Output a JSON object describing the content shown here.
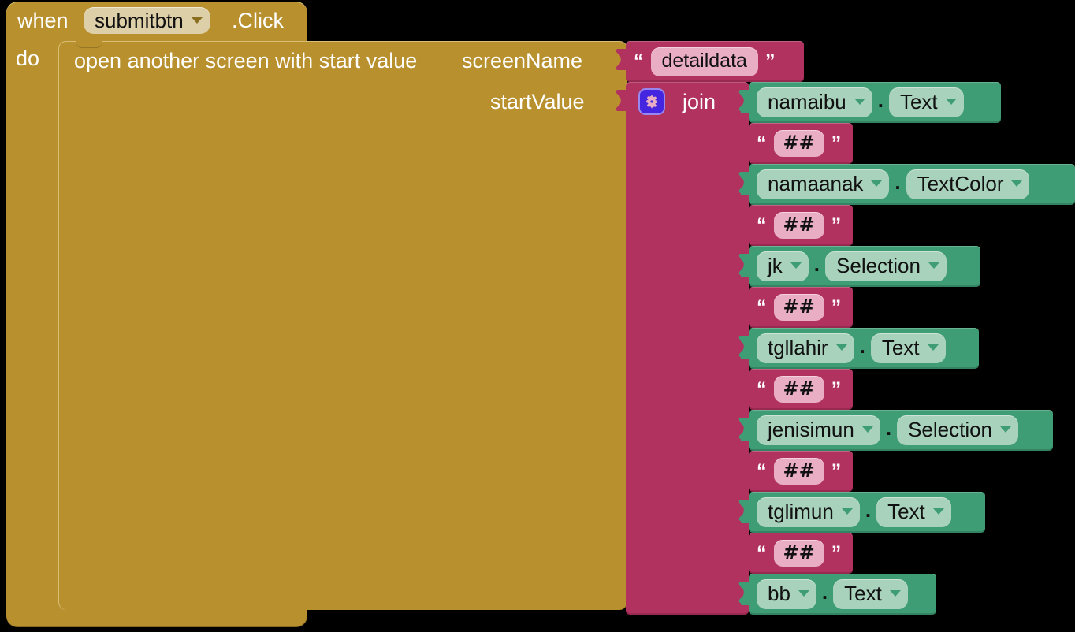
{
  "workspace": {
    "background_color": "#000000",
    "block_colors": {
      "control_gold": "#b8902e",
      "text_crimson": "#b1325f",
      "component_green": "#3f9d75",
      "field_pink": "#e9aec4",
      "field_green": "#a9d2bd",
      "field_gold": "#ddd0a8",
      "mutator_blue": "#4425e0"
    }
  },
  "event_block": {
    "when_label": "when",
    "component": "submitbtn",
    "event": ".Click",
    "do_label": "do"
  },
  "statement_block": {
    "label": "open another screen with start value",
    "sockets": [
      {
        "name": "screenName"
      },
      {
        "name": "startValue"
      }
    ]
  },
  "screen_name_value": {
    "type": "text",
    "open_quote": "“",
    "close_quote": "”",
    "value": "detaildata"
  },
  "join_block": {
    "mutator_icon": "gear-icon",
    "label": "join",
    "items": [
      {
        "kind": "component",
        "component": "namaibu",
        "dot": ".",
        "property": "Text"
      },
      {
        "kind": "text",
        "open_quote": "“",
        "value": "##",
        "close_quote": "”"
      },
      {
        "kind": "component",
        "component": "namaanak",
        "dot": ".",
        "property": "TextColor"
      },
      {
        "kind": "text",
        "open_quote": "“",
        "value": "##",
        "close_quote": "”"
      },
      {
        "kind": "component",
        "component": "jk",
        "dot": ".",
        "property": "Selection"
      },
      {
        "kind": "text",
        "open_quote": "“",
        "value": "##",
        "close_quote": "”"
      },
      {
        "kind": "component",
        "component": "tgllahir",
        "dot": ".",
        "property": "Text"
      },
      {
        "kind": "text",
        "open_quote": "“",
        "value": "##",
        "close_quote": "”"
      },
      {
        "kind": "component",
        "component": "jenisimun",
        "dot": ".",
        "property": "Selection"
      },
      {
        "kind": "text",
        "open_quote": "“",
        "value": "##",
        "close_quote": "”"
      },
      {
        "kind": "component",
        "component": "tglimun",
        "dot": ".",
        "property": "Text"
      },
      {
        "kind": "text",
        "open_quote": "“",
        "value": "##",
        "close_quote": "”"
      },
      {
        "kind": "component",
        "component": "bb",
        "dot": ".",
        "property": "Text"
      }
    ]
  }
}
